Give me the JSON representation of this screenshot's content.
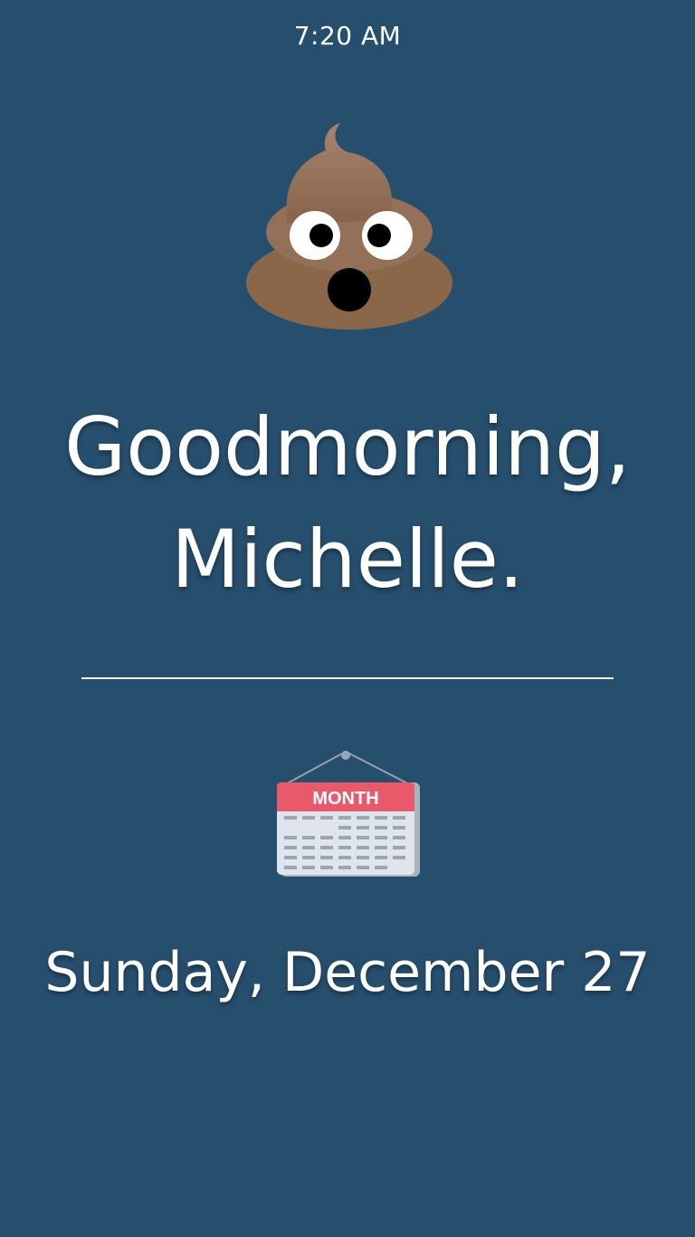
{
  "status_bar": {
    "time": "7:20 AM"
  },
  "mood": {
    "icon": "pile-of-poo-emoji"
  },
  "greeting": {
    "line1": "Goodmorning,",
    "line2": "Michelle."
  },
  "calendar": {
    "icon": "calendar-icon",
    "month_label": "MONTH"
  },
  "date": {
    "text": "Sunday, December 27"
  },
  "colors": {
    "background": "#264e6d",
    "text": "#ffffff",
    "calendar_header": "#e8596a"
  }
}
